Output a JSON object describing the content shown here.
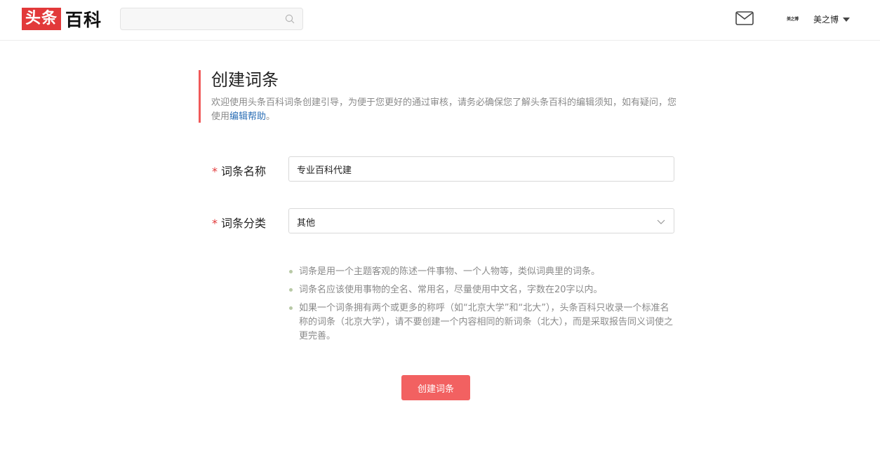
{
  "header": {
    "logo_red": "头条",
    "logo_black": "百科",
    "search_placeholder": "",
    "user_avatar_text": "美之博",
    "user_name": "美之博"
  },
  "intro": {
    "title": "创建词条",
    "text": "欢迎使用头条百科词条创建引导，为便于您更好的通过审核，请务必确保您了解头条百科的编辑须知，如有疑问，您使用",
    "link": "编辑帮助",
    "suffix": "。"
  },
  "form": {
    "required_mark": "*",
    "name_label": "词条名称",
    "name_value": "专业百科代建",
    "category_label": "词条分类",
    "category_value": "其他"
  },
  "tips": [
    "词条是用一个主题客观的陈述一件事物、一个人物等，类似词典里的词条。",
    "词条名应该使用事物的全名、常用名，尽量使用中文名，字数在20字以内。",
    "如果一个词条拥有两个或更多的称呼（如“北京大学”和“北大”），头条百科只收录一个标准名称的词条（北京大学），请不要创建一个内容相同的新词条（北大），而是采取报告同义词使之更完善。"
  ],
  "create_button": "创建词条",
  "colors": {
    "brand_red": "#e2393a",
    "accent": "#f05a5a",
    "button": "#f26161",
    "link": "#2a6eb5"
  }
}
